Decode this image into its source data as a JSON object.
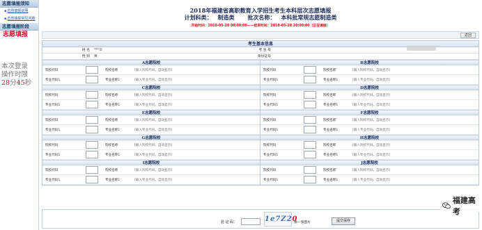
{
  "sidebar": {
    "head1": "志愿填报须知",
    "link1": "志愿填报说明",
    "link2": "志愿填报常见问题",
    "head2": "志愿填报阶段",
    "active": "志愿填报",
    "timer_line1": "本次登录",
    "timer_line2": "操作时限",
    "timer_min": "28",
    "timer_min_unit": "分",
    "timer_sec": "45",
    "timer_sec_unit": "秒"
  },
  "header": {
    "title": "2018年福建省高职教育入学招生考生本科层次志愿填报",
    "plan_label": "计划科类：",
    "plan_value": "制造类",
    "batch_label": "批次名称：",
    "batch_value": "本科批常规志愿制造类",
    "time_note": "开始时间：2018-05-20 08:00:00——结束时间：2018-05-28 20:00:00（正在填报）"
  },
  "toolbar": {
    "back_label": "返回"
  },
  "info": {
    "section_title": "考生基本信息",
    "name_label": "姓    名",
    "name_value": "***华",
    "exam_no_label": "考 生 号",
    "gender_label": "性    别",
    "gender_value": "男",
    "id_label": "身份证号"
  },
  "form_labels": {
    "school_code": "院校代码",
    "school_name": "院校名称",
    "major_code": "专业代码1",
    "major_name": "专业名称1",
    "hint_school": "[输入院校代码，自动显示]",
    "hint_major": "[输入专业代码，自动显示]"
  },
  "schools": [
    {
      "left": "A志愿院校",
      "right": "B志愿院校"
    },
    {
      "left": "C志愿院校",
      "right": "D志愿院校"
    },
    {
      "left": "E志愿院校",
      "right": "F志愿院校"
    },
    {
      "left": "G志愿院校",
      "right": "H志愿院校"
    },
    {
      "left": "I志愿院校",
      "right": "J志愿院校"
    }
  ],
  "footer": {
    "captcha_label": "验 证 码：",
    "captcha_text": "1e7Z2",
    "captcha_last": "0",
    "change_label": "换一张图片",
    "submit_label": "提交保存"
  },
  "watermark": {
    "text": "福建高考"
  }
}
